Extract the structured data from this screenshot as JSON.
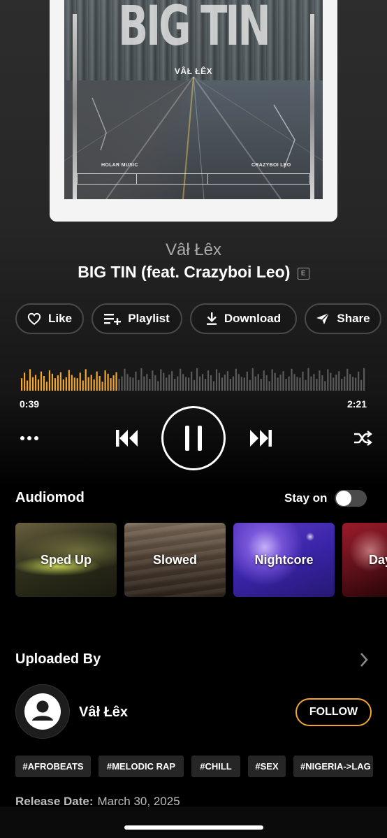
{
  "album_art": {
    "title": "BIG TIN",
    "artist": "VÂŁ ŁÊX",
    "label_left": "HOLAR MUSIC",
    "label_right": "CRAZYBOI LEO"
  },
  "track": {
    "artist": "Vâł Łêx",
    "title": "BIG TIN (feat. Crazyboi Leo)",
    "explicit_badge": "E"
  },
  "actions": {
    "like": "Like",
    "playlist": "Playlist",
    "download": "Download",
    "share": "Share"
  },
  "player": {
    "current_time": "0:39",
    "total_time": "2:21",
    "progress": 0.277,
    "played_color": "#f3a532",
    "unplayed_color": "#5a5a5a"
  },
  "audiomod": {
    "title": "Audiomod",
    "stay_on_label": "Stay on",
    "stay_on": false,
    "modes": [
      {
        "label": "Sped Up"
      },
      {
        "label": "Slowed"
      },
      {
        "label": "Nightcore"
      },
      {
        "label": "Day"
      }
    ]
  },
  "uploaded_by": {
    "title": "Uploaded By",
    "name": "Vâł Łêx",
    "follow_label": "FOLLOW",
    "tags": [
      "#AFROBEATS",
      "#MELODIC RAP",
      "#CHILL",
      "#SEX",
      "#NIGERIA->LAG"
    ]
  },
  "release": {
    "label": "Release Date:",
    "date": "March 30, 2025"
  },
  "colors": {
    "accent": "#f3a532",
    "background": "#000000"
  }
}
